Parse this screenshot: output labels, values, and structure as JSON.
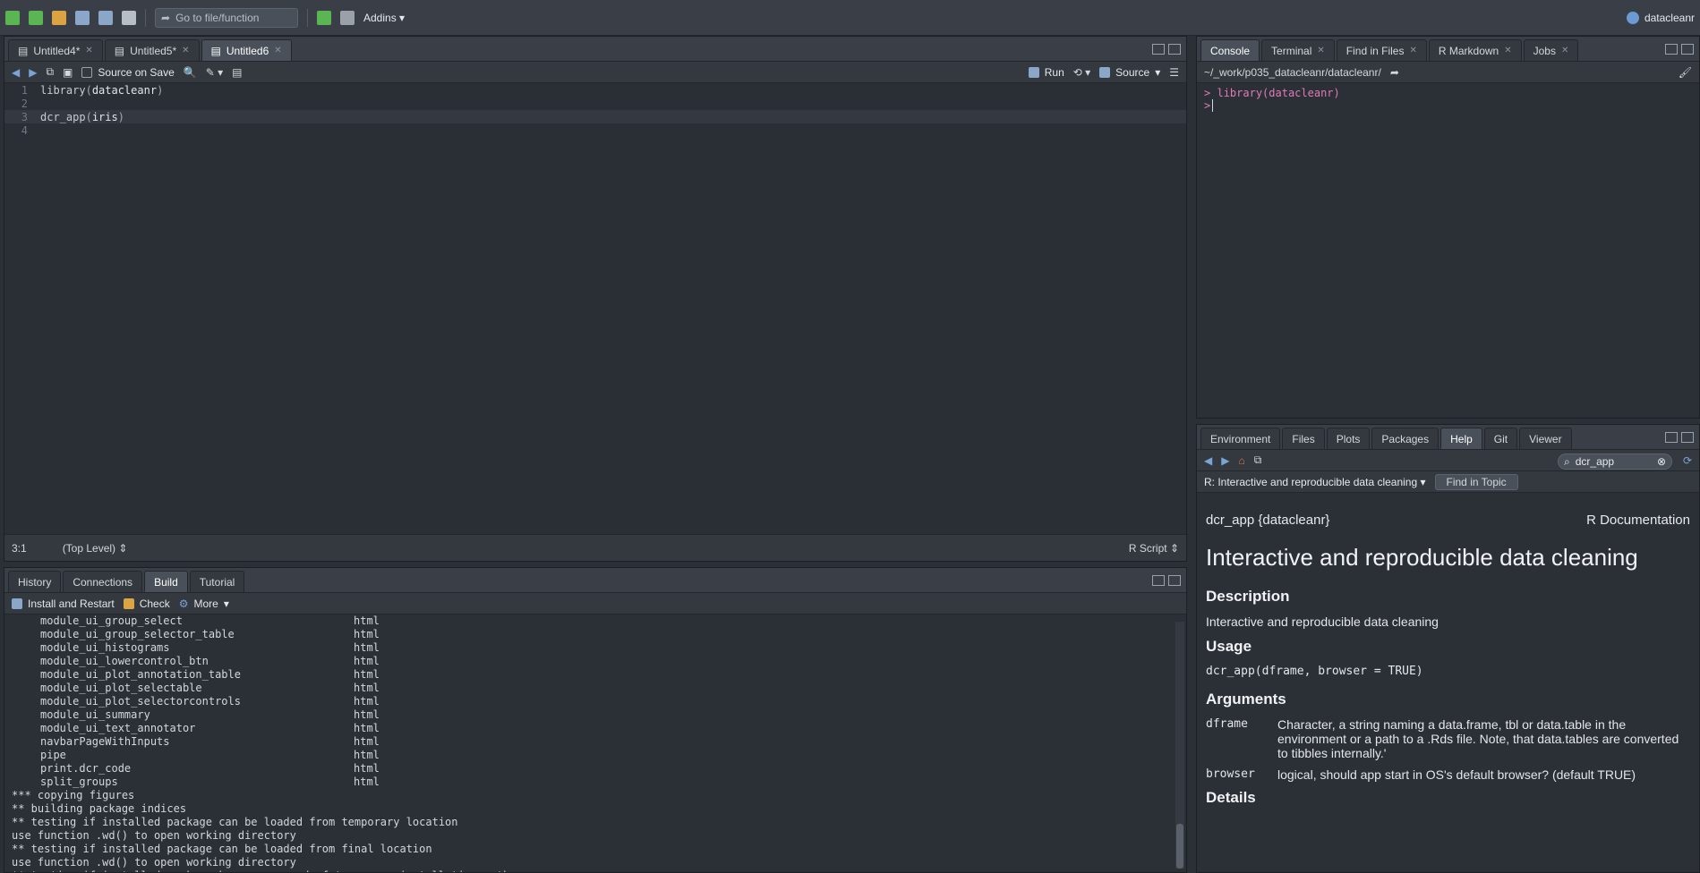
{
  "toolbar": {
    "goto_placeholder": "Go to file/function",
    "addins_label": "Addins",
    "project_name": "datacleanr"
  },
  "source_pane": {
    "tabs": [
      {
        "label": "Untitled4*"
      },
      {
        "label": "Untitled5*"
      },
      {
        "label": "Untitled6"
      }
    ],
    "source_on_save_label": "Source on Save",
    "run_label": "Run",
    "source_label": "Source",
    "code_lines": [
      {
        "num": "1",
        "fn": "library",
        "arg": "datacleanr"
      },
      {
        "num": "2",
        "fn": "",
        "arg": ""
      },
      {
        "num": "3",
        "fn": "dcr_app",
        "arg": "iris"
      },
      {
        "num": "4",
        "fn": "",
        "arg": ""
      }
    ],
    "status_position": "3:1",
    "status_scope": "(Top Level)",
    "status_type": "R Script"
  },
  "build_pane": {
    "tabs": [
      {
        "label": "History"
      },
      {
        "label": "Connections"
      },
      {
        "label": "Build"
      },
      {
        "label": "Tutorial"
      }
    ],
    "install_label": "Install and Restart",
    "check_label": "Check",
    "more_label": "More",
    "html_rows": [
      {
        "name": "module_ui_group_select",
        "type": "html"
      },
      {
        "name": "module_ui_group_selector_table",
        "type": "html"
      },
      {
        "name": "module_ui_histograms",
        "type": "html"
      },
      {
        "name": "module_ui_lowercontrol_btn",
        "type": "html"
      },
      {
        "name": "module_ui_plot_annotation_table",
        "type": "html"
      },
      {
        "name": "module_ui_plot_selectable",
        "type": "html"
      },
      {
        "name": "module_ui_plot_selectorcontrols",
        "type": "html"
      },
      {
        "name": "module_ui_summary",
        "type": "html"
      },
      {
        "name": "module_ui_text_annotator",
        "type": "html"
      },
      {
        "name": "navbarPageWithInputs",
        "type": "html"
      },
      {
        "name": "pipe",
        "type": "html"
      },
      {
        "name": "print.dcr_code",
        "type": "html"
      },
      {
        "name": "split_groups",
        "type": "html"
      }
    ],
    "log_lines": [
      "*** copying figures",
      "** building package indices",
      "** testing if installed package can be loaded from temporary location",
      "use function .wd() to open working directory",
      "** testing if installed package can be loaded from final location",
      "use function .wd() to open working directory",
      "** testing if installed package keeps a record of temporary installation path"
    ]
  },
  "console_pane": {
    "tabs": [
      {
        "label": "Console"
      },
      {
        "label": "Terminal"
      },
      {
        "label": "Find in Files"
      },
      {
        "label": "R Markdown"
      },
      {
        "label": "Jobs"
      }
    ],
    "path": "~/_work/p035_datacleanr/datacleanr/",
    "lines": [
      {
        "prompt": ">",
        "text": "library(datacleanr)"
      },
      {
        "prompt": ">",
        "text": ""
      }
    ]
  },
  "help_pane": {
    "tabs": [
      {
        "label": "Environment"
      },
      {
        "label": "Files"
      },
      {
        "label": "Plots"
      },
      {
        "label": "Packages"
      },
      {
        "label": "Help"
      },
      {
        "label": "Git"
      },
      {
        "label": "Viewer"
      }
    ],
    "search_value": "dcr_app",
    "topic_select": "R: Interactive and reproducible data cleaning",
    "find_in_topic": "Find in Topic",
    "doc_name": "dcr_app {datacleanr}",
    "doc_source": "R Documentation",
    "title": "Interactive and reproducible data cleaning",
    "description_heading": "Description",
    "description_text": "Interactive and reproducible data cleaning",
    "usage_heading": "Usage",
    "usage_code": "dcr_app(dframe, browser = TRUE)",
    "arguments_heading": "Arguments",
    "arguments": [
      {
        "name": "dframe",
        "desc": "Character, a string naming a data.frame, tbl or data.table in the environment or a path to a .Rds file. Note, that data.tables are converted to tibbles internally.'"
      },
      {
        "name": "browser",
        "desc": "logical, should app start in OS's default browser? (default TRUE)"
      }
    ],
    "details_heading": "Details"
  }
}
